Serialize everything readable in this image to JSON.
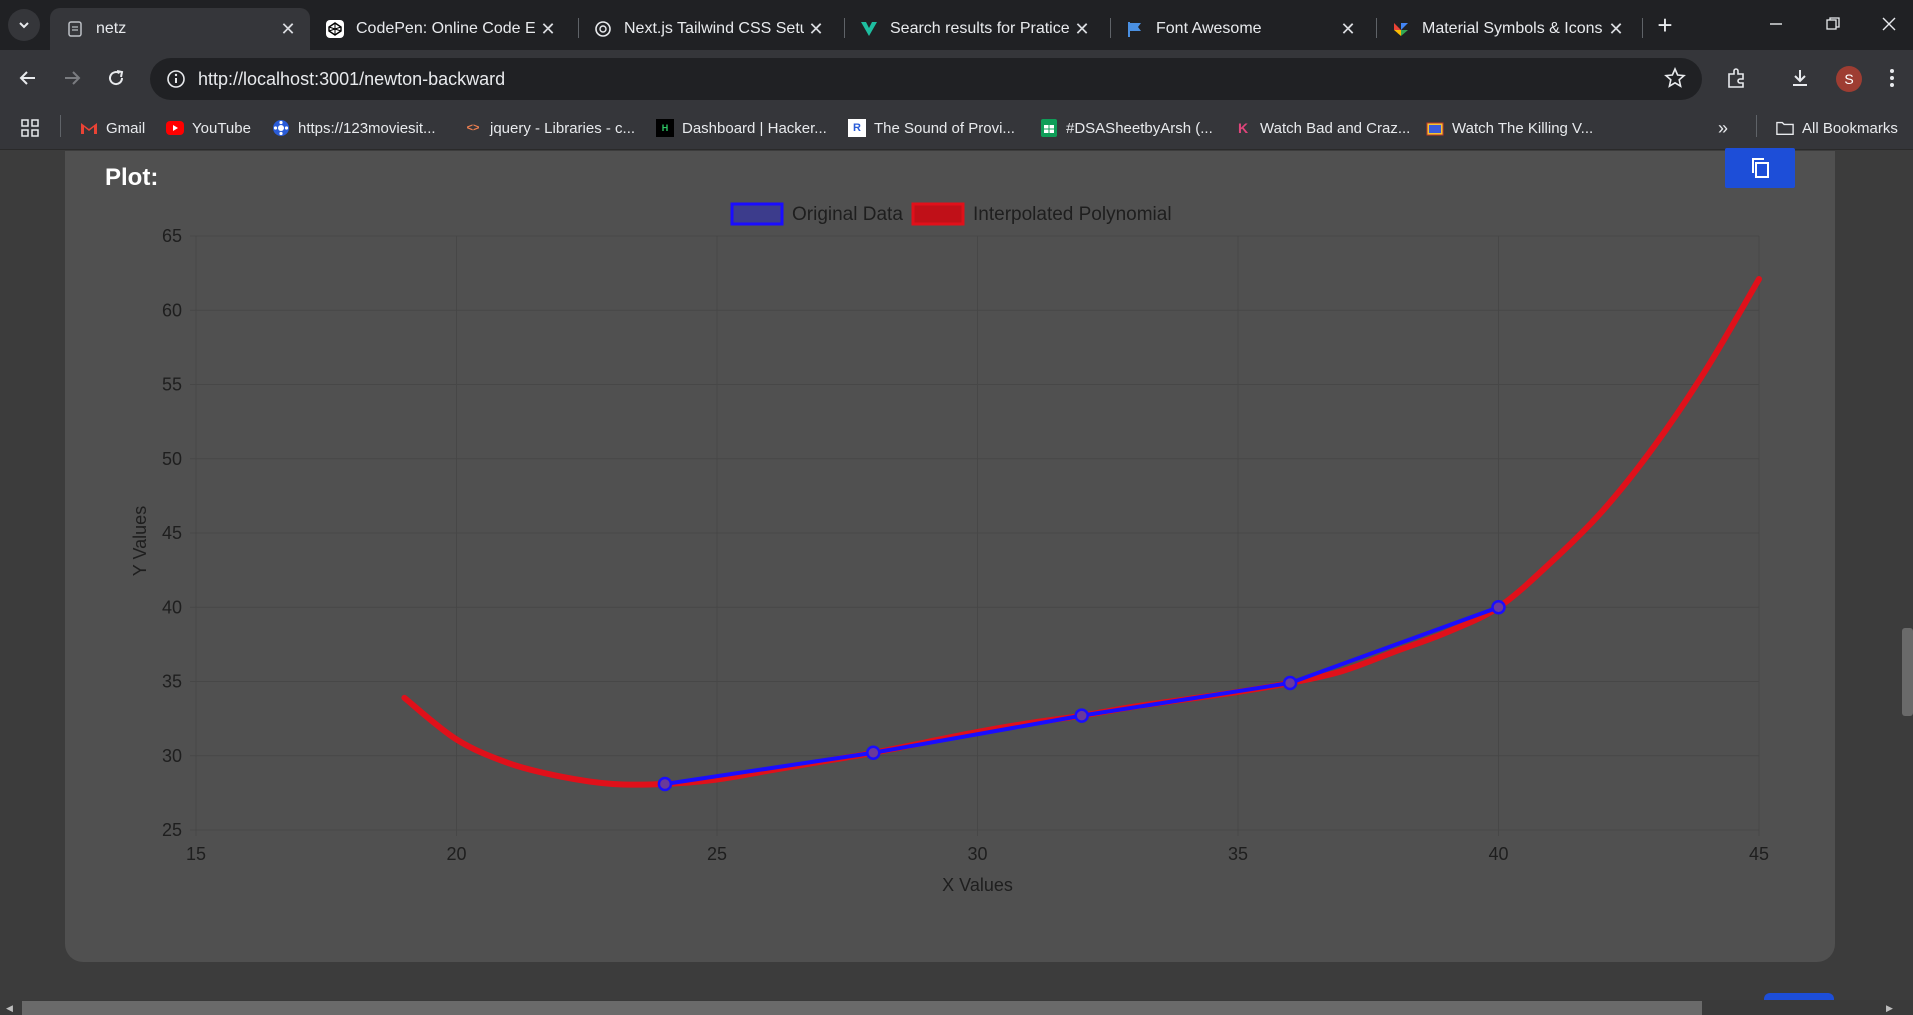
{
  "tabs": [
    {
      "title": "netz",
      "icon": "page-icon",
      "active": true
    },
    {
      "title": "CodePen: Online Code Edit",
      "icon": "codepen-icon",
      "active": false
    },
    {
      "title": "Next.js Tailwind CSS Setup",
      "icon": "openai-icon",
      "active": false
    },
    {
      "title": "Search results for Pratice -",
      "icon": "vuetify-icon",
      "active": false
    },
    {
      "title": "Font Awesome",
      "icon": "flag-icon",
      "active": false
    },
    {
      "title": "Material Symbols & Icons -",
      "icon": "material-icon",
      "active": false
    }
  ],
  "toolbar": {
    "url": "http://localhost:3001/newton-backward",
    "avatar_letter": "S"
  },
  "bookmarks": [
    {
      "label": "Gmail",
      "icon": "gmail-icon"
    },
    {
      "label": "YouTube",
      "icon": "youtube-icon"
    },
    {
      "label": "https://123moviesit...",
      "icon": "film-icon"
    },
    {
      "label": "jquery - Libraries - c...",
      "icon": "code-icon"
    },
    {
      "label": "Dashboard | Hacker...",
      "icon": "hackerrank-icon"
    },
    {
      "label": "The Sound of Provi...",
      "icon": "r-icon"
    },
    {
      "label": "#DSASheetbyArsh (...",
      "icon": "sheets-icon"
    },
    {
      "label": "Watch Bad and Craz...",
      "icon": "k-icon"
    },
    {
      "label": "Watch The Killing V...",
      "icon": "tv-icon"
    }
  ],
  "bookmarks_all": "All Bookmarks",
  "page": {
    "section_title": "Plot:"
  },
  "colors": {
    "original": "#1a0dff",
    "interpolated": "#e0101a",
    "card": "#505050",
    "accent": "#1d4ed8"
  },
  "chart_data": {
    "type": "line",
    "legend": [
      "Original Data",
      "Interpolated Polynomial"
    ],
    "legend_position": "top-center",
    "xlabel": "X Values",
    "ylabel": "Y Values",
    "xlim": [
      15,
      45
    ],
    "ylim": [
      25,
      65
    ],
    "x_ticks": [
      15,
      20,
      25,
      30,
      35,
      40,
      45
    ],
    "y_ticks": [
      25,
      30,
      35,
      40,
      45,
      50,
      55,
      60,
      65
    ],
    "grid": true,
    "series": [
      {
        "name": "Original Data",
        "color": "#1a0dff",
        "x": [
          24,
          28,
          32,
          36,
          40
        ],
        "y": [
          28.1,
          30.2,
          32.7,
          34.9,
          40.0
        ]
      },
      {
        "name": "Interpolated Polynomial",
        "color": "#e0101a",
        "x": [
          19,
          20,
          21,
          22,
          23,
          24,
          25,
          26,
          27,
          28,
          29,
          30,
          31,
          32,
          33,
          34,
          35,
          36,
          37,
          38,
          39,
          40,
          41,
          42,
          43,
          44,
          45
        ],
        "y": [
          33.9,
          31.1,
          29.5,
          28.6,
          28.1,
          28.1,
          28.4,
          29.0,
          29.6,
          30.2,
          30.9,
          31.6,
          32.2,
          32.7,
          33.3,
          33.8,
          34.3,
          34.9,
          35.7,
          37.0,
          38.3,
          40.0,
          43.0,
          46.5,
          50.9,
          56.1,
          62.1
        ]
      }
    ]
  }
}
